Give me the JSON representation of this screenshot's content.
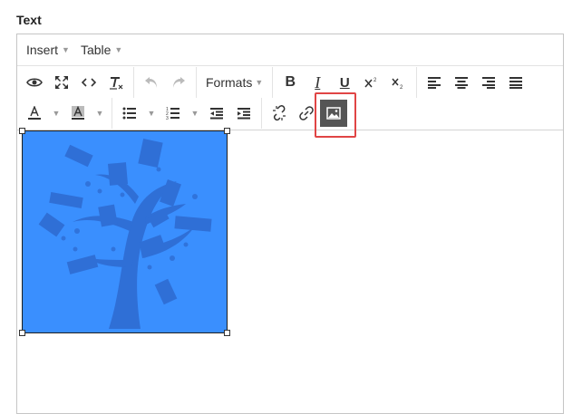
{
  "field": {
    "label": "Text"
  },
  "menubar": {
    "items": [
      {
        "label": "Insert"
      },
      {
        "label": "Table"
      }
    ]
  },
  "toolbar": {
    "formats_label": "Formats",
    "bold_label": "B",
    "italic_label": "I",
    "underline_label": "U",
    "highlight_color": "#e04545",
    "active_bg": "#555555"
  },
  "icons": [
    "preview-icon",
    "fullscreen-icon",
    "source-code-icon",
    "clear-formatting-icon",
    "undo-icon",
    "redo-icon",
    "superscript-icon",
    "subscript-icon",
    "align-left-icon",
    "align-center-icon",
    "align-right-icon",
    "align-justify-icon",
    "text-color-icon",
    "background-color-icon",
    "bullet-list-icon",
    "numbered-list-icon",
    "outdent-icon",
    "indent-icon",
    "unlink-icon",
    "link-icon",
    "image-icon"
  ],
  "content": {
    "image_bg": "#3a8ffe",
    "image_art_color": "#2f6fd6"
  }
}
